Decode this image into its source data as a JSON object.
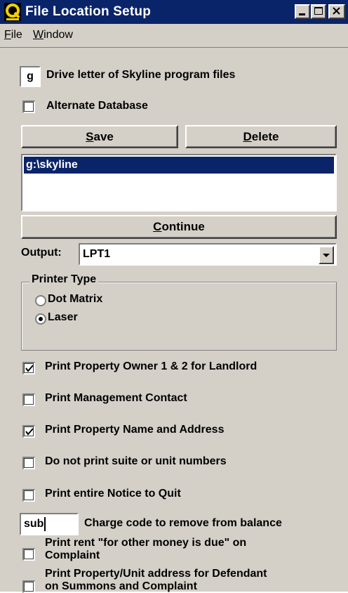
{
  "window": {
    "title": "File Location Setup"
  },
  "menu": [
    {
      "accel": "F",
      "rest": "ile"
    },
    {
      "accel": "W",
      "rest": "indow"
    }
  ],
  "drive": {
    "value": "g",
    "label": "Drive letter of Skyline program files"
  },
  "alternate_db": {
    "label": "Alternate Database",
    "checked": false
  },
  "buttons": {
    "save_accel": "S",
    "save_rest": "ave",
    "delete_accel": "D",
    "delete_rest": "elete",
    "continue_accel": "C",
    "continue_rest": "ontinue"
  },
  "paths": [
    "g:\\skyline"
  ],
  "output": {
    "label": "Output:",
    "value": "LPT1"
  },
  "printer_type": {
    "title": "Printer Type",
    "options": [
      "Dot Matrix",
      "Laser"
    ],
    "selected": "Laser"
  },
  "options": [
    {
      "label": "Print Property Owner 1 & 2 for Landlord",
      "checked": true
    },
    {
      "label": "Print Management Contact",
      "checked": false
    },
    {
      "label": "Print Property Name and Address",
      "checked": true
    },
    {
      "label": "Do not print suite or unit numbers",
      "checked": false
    },
    {
      "label": "Print entire Notice to Quit",
      "checked": false
    }
  ],
  "charge_code": {
    "value": "sub",
    "label": "Charge code to remove from balance"
  },
  "extra_options": [
    {
      "line1": "Print rent \"for other money is due\" on",
      "line2": "Complaint",
      "checked": false
    },
    {
      "line1": "Print Property/Unit address for Defendant",
      "line2": "on Summons and Complaint",
      "checked": false
    }
  ],
  "colors": {
    "titlebar": "#0a246a",
    "face": "#d4d0c8",
    "selection": "#0a246a"
  },
  "icons": {
    "app": "q-logo-icon",
    "minimize": "minimize-icon",
    "maximize": "maximize-icon",
    "close": "close-icon"
  }
}
